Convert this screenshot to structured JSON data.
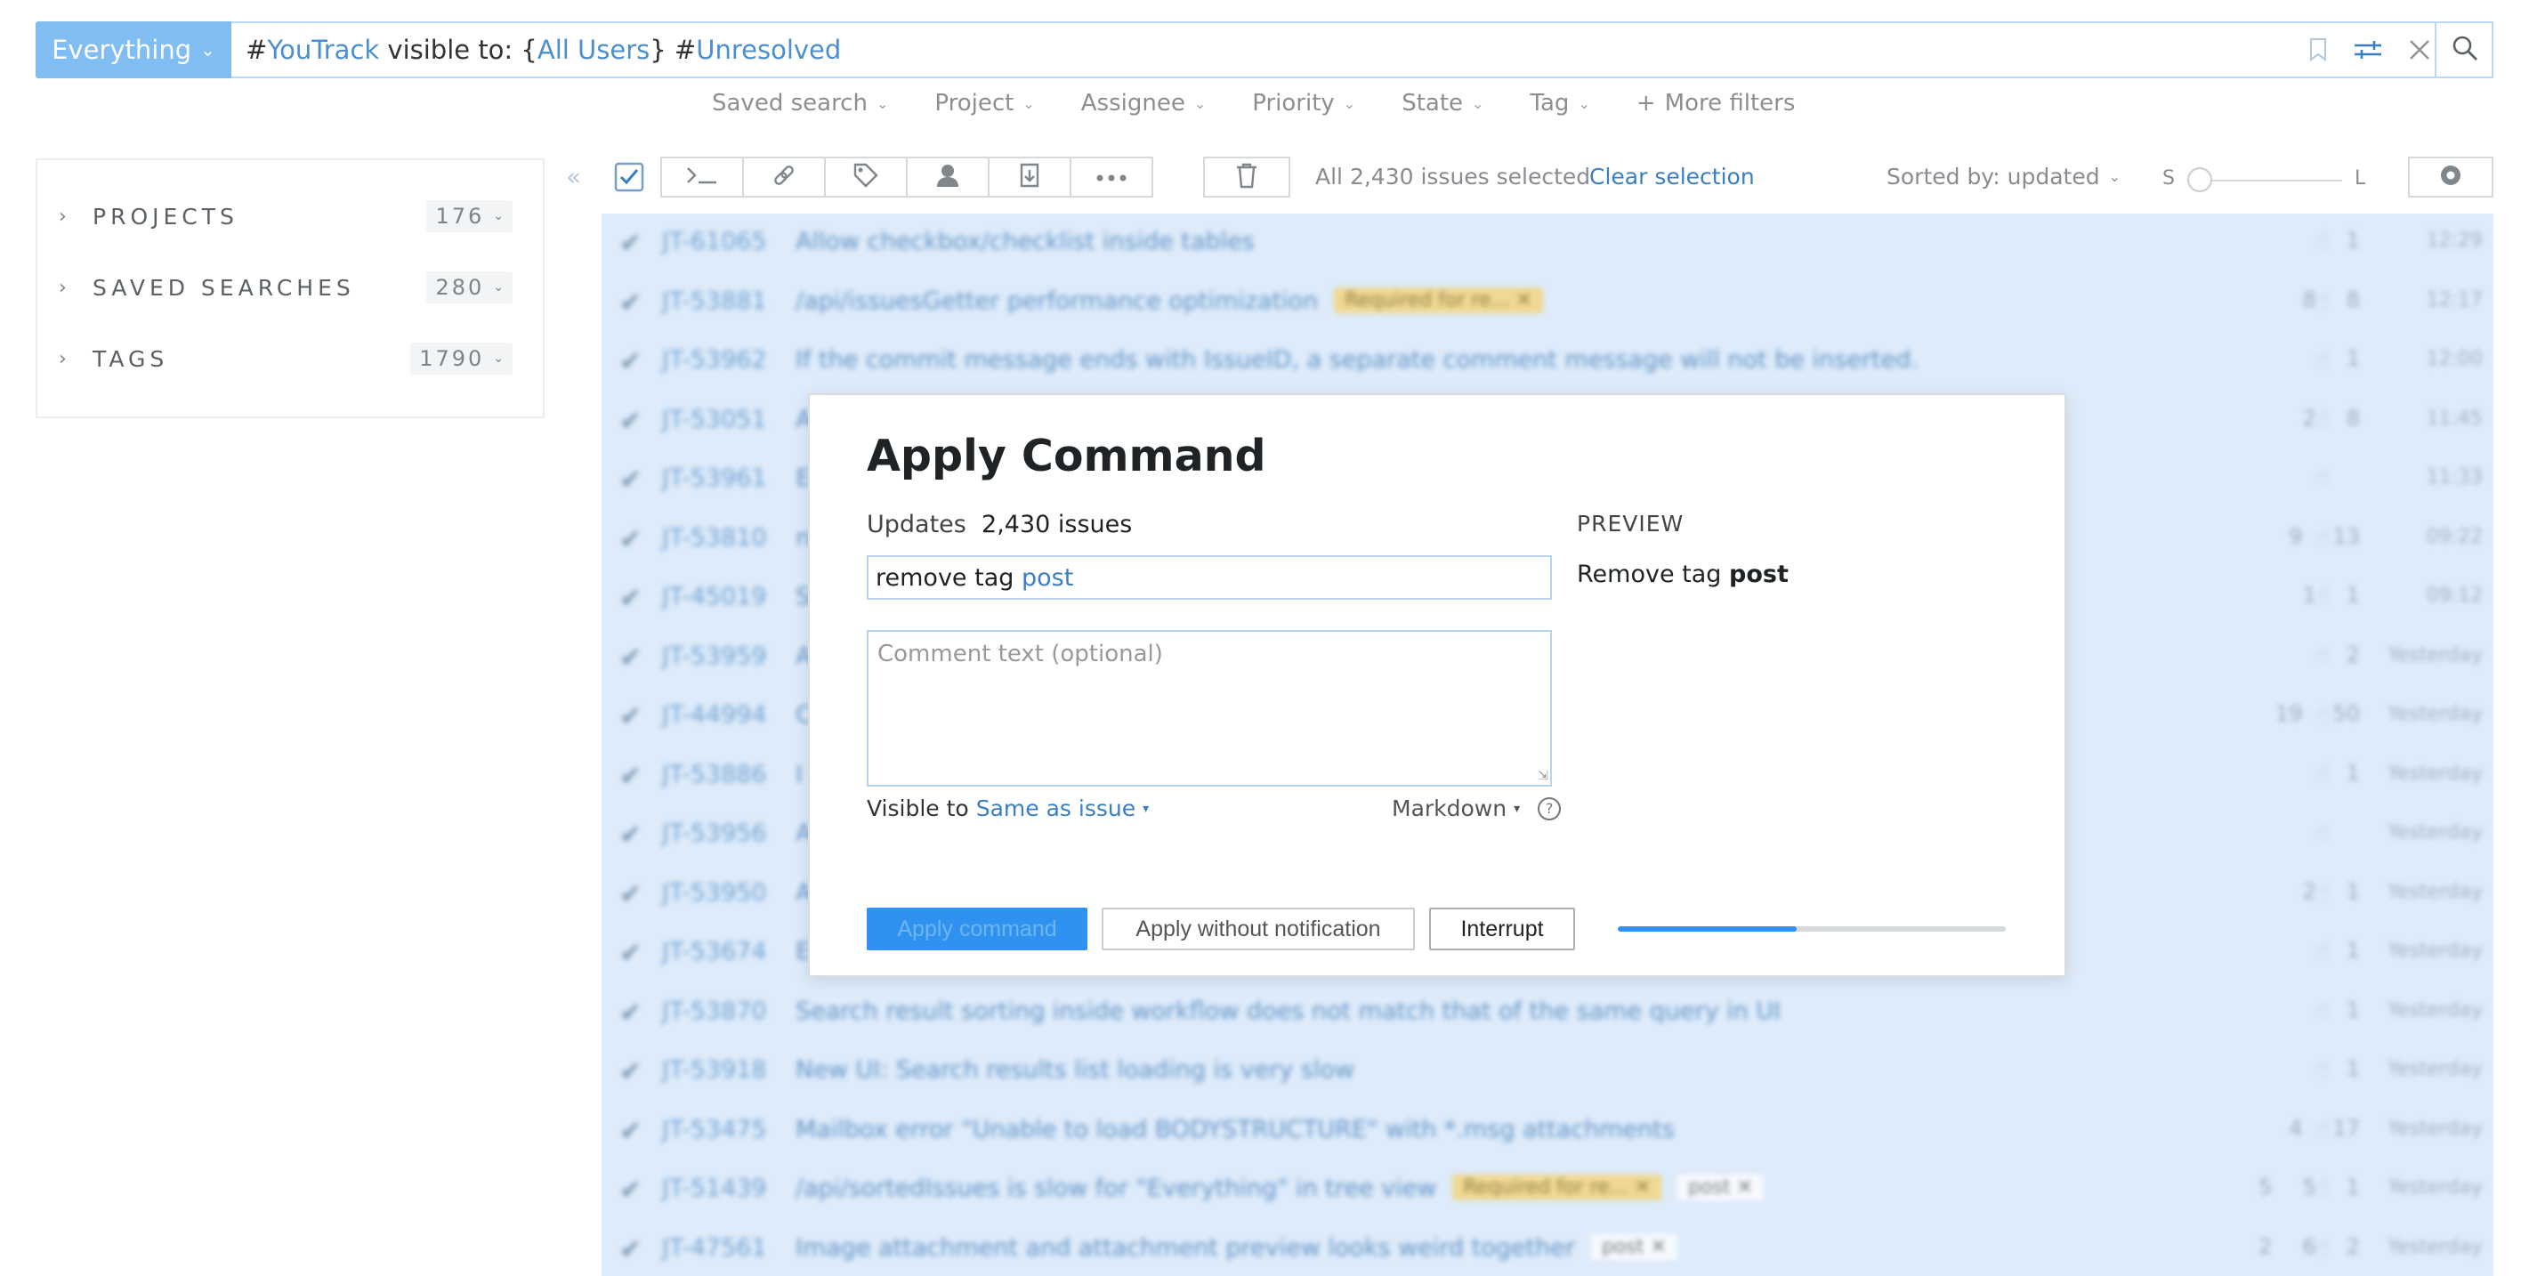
{
  "search": {
    "context_label": "Everything",
    "query_parts": [
      {
        "text": "#",
        "kind": "tx"
      },
      {
        "text": "YouTrack",
        "kind": "kw"
      },
      {
        "text": " visible to: {",
        "kind": "tx"
      },
      {
        "text": "All Users",
        "kind": "kw"
      },
      {
        "text": "} #",
        "kind": "tx"
      },
      {
        "text": "Unresolved",
        "kind": "kw"
      }
    ]
  },
  "filters": [
    "Saved search",
    "Project",
    "Assignee",
    "Priority",
    "State",
    "Tag"
  ],
  "more_filters": "More filters",
  "sidebar": {
    "items": [
      {
        "label": "PROJECTS",
        "count": "176"
      },
      {
        "label": "SAVED SEARCHES",
        "count": "280"
      },
      {
        "label": "TAGS",
        "count": "1790"
      }
    ]
  },
  "toolbar": {
    "selection_text": "All 2,430 issues selected",
    "clear_selection": "Clear selection",
    "sorted_by": "Sorted by: updated",
    "size_small": "S",
    "size_large": "L"
  },
  "issues": [
    {
      "id": "JT-61065",
      "summary": "Allow checkbox/checklist inside tables",
      "tags": [],
      "stats": [
        "1"
      ],
      "time": "12:29"
    },
    {
      "id": "JT-53881",
      "summary": "/api/issuesGetter performance optimization",
      "tags": [
        {
          "text": "Required for re... ✕",
          "style": "yellow"
        }
      ],
      "stats": [
        "8",
        "8"
      ],
      "time": "12:17"
    },
    {
      "id": "JT-53962",
      "summary": "If the commit message ends with IssueID, a separate comment message will not be inserted.",
      "tags": [],
      "stats": [
        "1"
      ],
      "time": "12:00"
    },
    {
      "id": "JT-53051",
      "summary": "A",
      "tags": [],
      "stats": [
        "2",
        "8"
      ],
      "time": "11:45"
    },
    {
      "id": "JT-53961",
      "summary": "E",
      "tags": [],
      "stats": [],
      "time": "11:33"
    },
    {
      "id": "JT-53810",
      "summary": "n",
      "tags": [],
      "stats": [
        "9",
        "13"
      ],
      "time": "09:22"
    },
    {
      "id": "JT-45019",
      "summary": "S",
      "tags": [],
      "stats": [
        "1",
        "1"
      ],
      "time": "09:12"
    },
    {
      "id": "JT-53959",
      "summary": "A",
      "tags": [],
      "stats": [
        "2"
      ],
      "time": "Yesterday"
    },
    {
      "id": "JT-44994",
      "summary": "C",
      "tags": [],
      "stats": [
        "19",
        "50"
      ],
      "time": "Yesterday"
    },
    {
      "id": "JT-53886",
      "summary": "I",
      "tags": [],
      "stats": [
        "1"
      ],
      "time": "Yesterday"
    },
    {
      "id": "JT-53956",
      "summary": "A",
      "tags": [],
      "stats": [],
      "time": "Yesterday"
    },
    {
      "id": "JT-53950",
      "summary": "A",
      "tags": [],
      "stats": [
        "2",
        "1"
      ],
      "time": "Yesterday"
    },
    {
      "id": "JT-53674",
      "summary": "E",
      "tags": [],
      "stats": [
        "1"
      ],
      "time": "Yesterday"
    },
    {
      "id": "JT-53870",
      "summary": "Search result sorting inside workflow does not match that of the same query in UI",
      "tags": [],
      "stats": [
        "1"
      ],
      "time": "Yesterday"
    },
    {
      "id": "JT-53918",
      "summary": "New UI: Search results list loading is very slow",
      "tags": [],
      "stats": [
        "1"
      ],
      "time": "Yesterday"
    },
    {
      "id": "JT-53475",
      "summary": "Mailbox error \"Unable to load BODYSTRUCTURE\" with *.msg attachments",
      "tags": [],
      "stats": [
        "4",
        "17"
      ],
      "time": "Yesterday"
    },
    {
      "id": "JT-51439",
      "summary": "/api/sortedIssues is slow for \"Everything\" in tree view",
      "tags": [
        {
          "text": "Required for re... ✕",
          "style": "yellow"
        },
        {
          "text": "post ✕",
          "style": "white"
        }
      ],
      "stats": [
        "5",
        "5",
        "1"
      ],
      "time": "Yesterday"
    },
    {
      "id": "JT-47561",
      "summary": "Image attachment and attachment preview looks weird together",
      "tags": [
        {
          "text": "post ✕",
          "style": "white"
        }
      ],
      "stats": [
        "2",
        "6",
        "2"
      ],
      "time": "Yesterday"
    }
  ],
  "dialog": {
    "title": "Apply Command",
    "updates_label": "Updates",
    "updates_count": "2,430 issues",
    "command_parts": [
      {
        "text": "remove tag ",
        "kind": "tx"
      },
      {
        "text": "post",
        "kind": "kw"
      }
    ],
    "comment_placeholder": "Comment text (optional)",
    "visible_to_label": "Visible to",
    "visible_to_value": "Same as issue",
    "markdown_label": "Markdown",
    "help_symbol": "?",
    "preview_label": "PREVIEW",
    "preview_prefix": "Remove tag ",
    "preview_bold": "post",
    "apply_button": "Apply command",
    "notify_button": "Apply without notification",
    "interrupt_button": "Interrupt",
    "progress_fraction": 0.46
  },
  "colors": {
    "accent": "#2f91f0",
    "context_button": "#7fbdf3",
    "selection_background": "#ddebfa",
    "link": "#3a7fc1"
  },
  "icons": [
    "bookmark-icon",
    "filter-settings-icon",
    "clear-icon",
    "search-icon",
    "collapse-icon",
    "command-icon",
    "link-icon",
    "tag-icon",
    "assignee-icon",
    "move-icon",
    "more-icon",
    "delete-icon",
    "settings-icon",
    "chevron-right-icon",
    "chevron-down-icon"
  ]
}
